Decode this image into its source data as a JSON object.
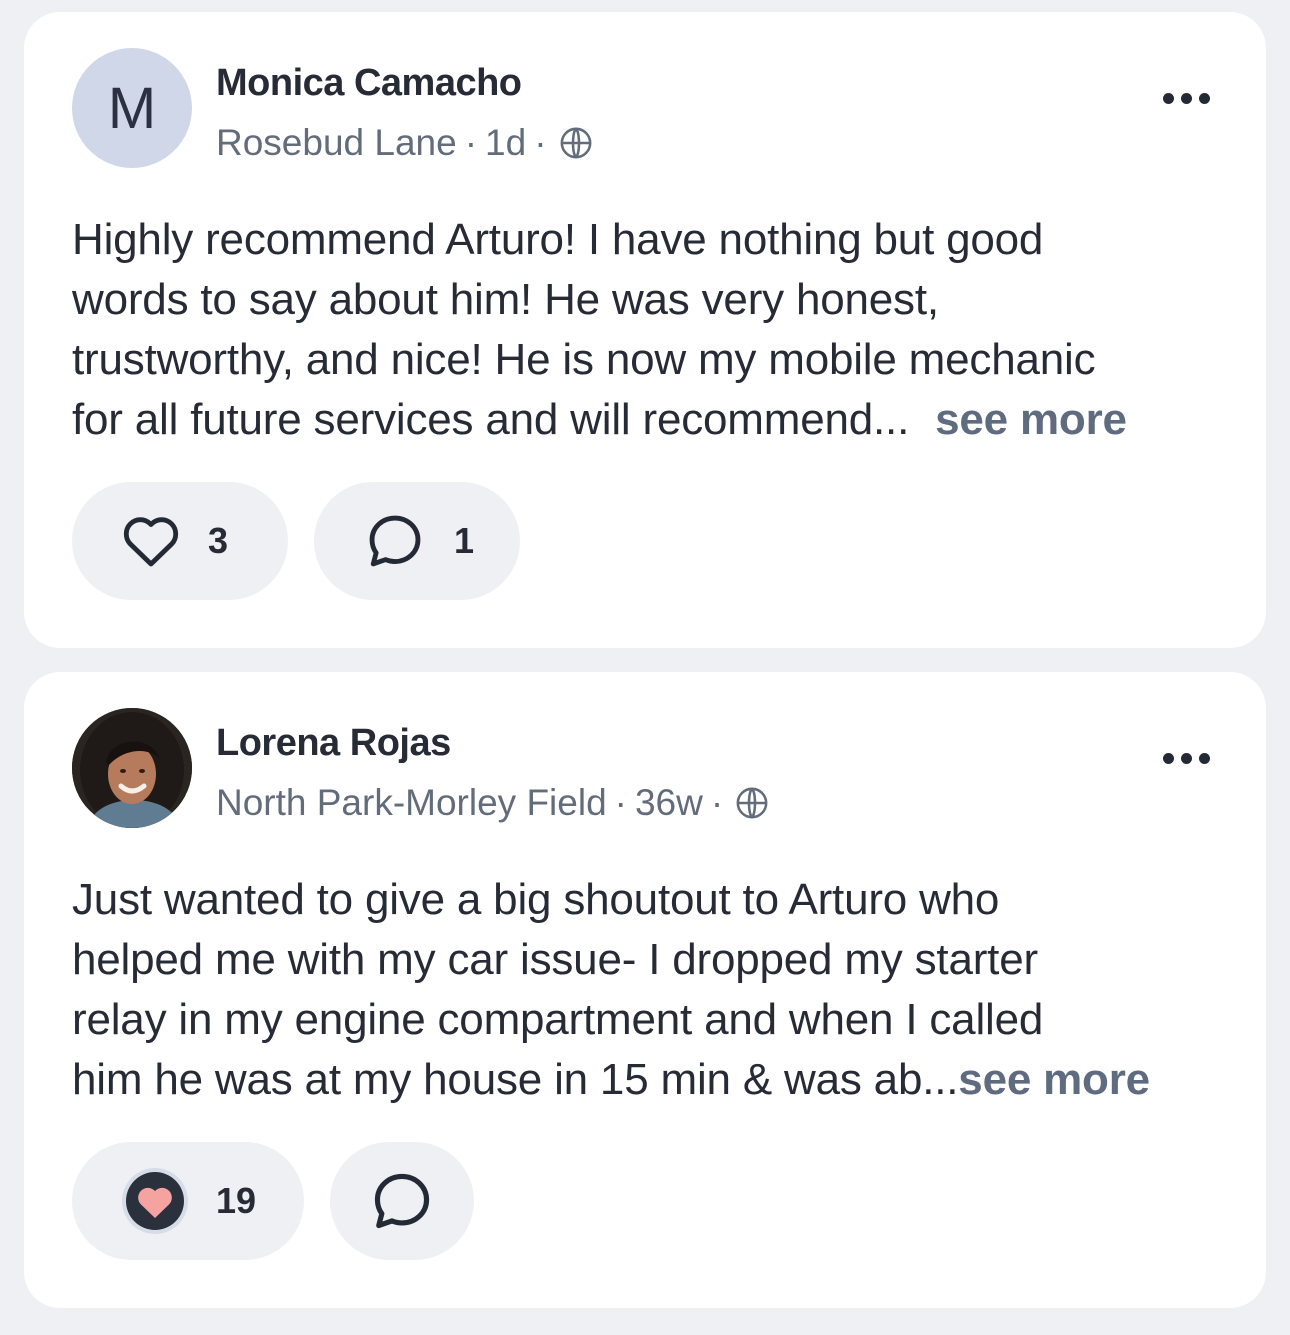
{
  "posts": [
    {
      "author": "Monica Camacho",
      "avatar_letter": "M",
      "neighborhood": "Rosebud Lane",
      "dot": "·",
      "time": "1d",
      "body_lines": [
        "Highly recommend Arturo! I have nothing but good",
        "words to say about him! He was very honest,",
        "trustworthy, and nice! He is now my mobile mechanic",
        "for all future services and will recommend..."
      ],
      "see_more": "see more",
      "reaction_count": "3",
      "comment_count": "1",
      "reaction_icon": "heart-outline-icon",
      "visibility_icon": "globe-icon"
    },
    {
      "author": "Lorena Rojas",
      "neighborhood": "North Park-Morley Field",
      "dot": "·",
      "time": "36w",
      "body_lines": [
        "Just wanted to give a big shoutout to Arturo who",
        "helped me with my car issue- I dropped my starter",
        "relay in my engine compartment and when I called",
        "him he was at my house in 15 min & was ab..."
      ],
      "see_more": "see more",
      "reaction_count": "19",
      "reaction_icon": "heart-filled-icon",
      "visibility_icon": "globe-icon",
      "heart_color": "#f4a3a0"
    }
  ]
}
